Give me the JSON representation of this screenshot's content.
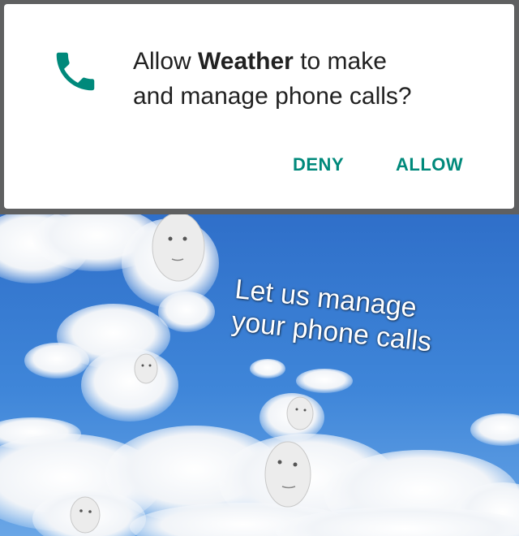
{
  "dialog": {
    "icon": "phone-icon",
    "accent_color": "#00897b",
    "message_prefix": "Allow ",
    "app_name": "Weather",
    "message_suffix_line1": " to make",
    "message_line2": "and manage phone calls?",
    "deny_label": "DENY",
    "allow_label": "ALLOW"
  },
  "meme": {
    "background": "blue sky with clouds and faces",
    "caption_line1": "Let us manage",
    "caption_line2": "your phone calls"
  }
}
